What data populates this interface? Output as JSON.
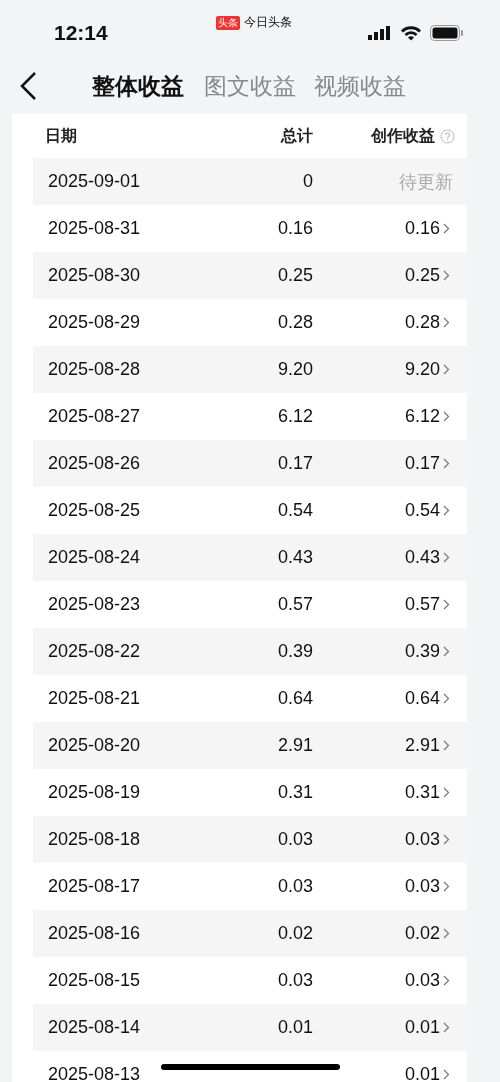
{
  "status_bar": {
    "time": "12:14",
    "app_badge": "头条",
    "app_name": "今日头条"
  },
  "tabs": [
    {
      "label": "整体收益",
      "selected": true
    },
    {
      "label": "图文收益",
      "selected": false
    },
    {
      "label": "视频收益",
      "selected": false
    }
  ],
  "table": {
    "columns": [
      "日期",
      "总计",
      "创作收益"
    ],
    "rows": [
      {
        "date": "2025-09-01",
        "total": "0",
        "earning": "待更新",
        "kind": "pending"
      },
      {
        "date": "2025-08-31",
        "total": "0.16",
        "earning": "0.16",
        "kind": "amount"
      },
      {
        "date": "2025-08-30",
        "total": "0.25",
        "earning": "0.25",
        "kind": "amount"
      },
      {
        "date": "2025-08-29",
        "total": "0.28",
        "earning": "0.28",
        "kind": "amount"
      },
      {
        "date": "2025-08-28",
        "total": "9.20",
        "earning": "9.20",
        "kind": "amount"
      },
      {
        "date": "2025-08-27",
        "total": "6.12",
        "earning": "6.12",
        "kind": "amount"
      },
      {
        "date": "2025-08-26",
        "total": "0.17",
        "earning": "0.17",
        "kind": "amount"
      },
      {
        "date": "2025-08-25",
        "total": "0.54",
        "earning": "0.54",
        "kind": "amount"
      },
      {
        "date": "2025-08-24",
        "total": "0.43",
        "earning": "0.43",
        "kind": "amount"
      },
      {
        "date": "2025-08-23",
        "total": "0.57",
        "earning": "0.57",
        "kind": "amount"
      },
      {
        "date": "2025-08-22",
        "total": "0.39",
        "earning": "0.39",
        "kind": "amount"
      },
      {
        "date": "2025-08-21",
        "total": "0.64",
        "earning": "0.64",
        "kind": "amount"
      },
      {
        "date": "2025-08-20",
        "total": "2.91",
        "earning": "2.91",
        "kind": "amount"
      },
      {
        "date": "2025-08-19",
        "total": "0.31",
        "earning": "0.31",
        "kind": "amount"
      },
      {
        "date": "2025-08-18",
        "total": "0.03",
        "earning": "0.03",
        "kind": "amount"
      },
      {
        "date": "2025-08-17",
        "total": "0.03",
        "earning": "0.03",
        "kind": "amount"
      },
      {
        "date": "2025-08-16",
        "total": "0.02",
        "earning": "0.02",
        "kind": "amount"
      },
      {
        "date": "2025-08-15",
        "total": "0.03",
        "earning": "0.03",
        "kind": "amount"
      },
      {
        "date": "2025-08-14",
        "total": "0.01",
        "earning": "0.01",
        "kind": "amount"
      },
      {
        "date": "2025-08-13",
        "earning": "0.01",
        "kind": "amount"
      }
    ]
  }
}
